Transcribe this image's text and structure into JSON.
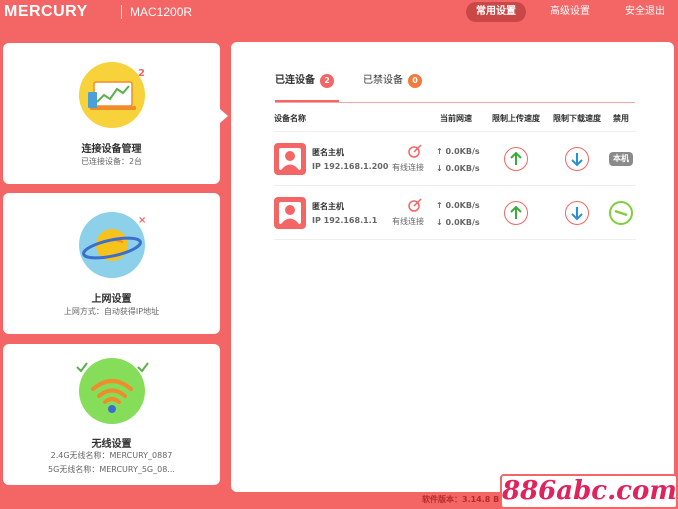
{
  "header": {
    "logo": "MERCURY",
    "model": "MAC1200R",
    "nav": {
      "common": "常用设置",
      "advanced": "高级设置",
      "logout": "安全退出"
    }
  },
  "sidebar": {
    "cards": [
      {
        "title": "连接设备管理",
        "subtitle": "已连接设备：2台",
        "badge": "2",
        "icon": "laptop-chart-icon"
      },
      {
        "title": "上网设置",
        "subtitle": "上网方式：自动获得IP地址",
        "badge": "×",
        "icon": "planet-icon"
      },
      {
        "title": "无线设置",
        "line1": "2.4G无线名称：MERCURY_0887",
        "line2": "5G无线名称：MERCURY_5G_08...",
        "icon": "wifi-icon"
      }
    ]
  },
  "main": {
    "tabs": [
      {
        "label": "已连设备",
        "count": "2"
      },
      {
        "label": "已禁设备",
        "count": "0"
      }
    ],
    "columns": {
      "name": "设备名称",
      "speed": "当前网速",
      "up_limit": "限制上传速度",
      "down_limit": "限制下载速度",
      "ban": "禁用"
    },
    "devices": [
      {
        "name": "匿名主机",
        "ip": "IP 192.168.1.200",
        "conn": "有线连接",
        "up": "↑ 0.0KB/s",
        "down": "↓ 0.0KB/s",
        "ban_label": "本机"
      },
      {
        "name": "匿名主机",
        "ip": "IP 192.168.1.1",
        "conn": "有线连接",
        "up": "↑ 0.0KB/s",
        "down": "↓ 0.0KB/s",
        "ban_label": ""
      }
    ]
  },
  "footer": {
    "version": "软件版本：3.14.8 Bu",
    "watermark": "886abc.com"
  },
  "colors": {
    "brand": "#f36665",
    "accent_yellow": "#f8d23b",
    "accent_blue": "#8cd0ea",
    "accent_green": "#86dd5a",
    "up_arrow": "#3aaa3a",
    "down_arrow": "#2a8fd8"
  }
}
